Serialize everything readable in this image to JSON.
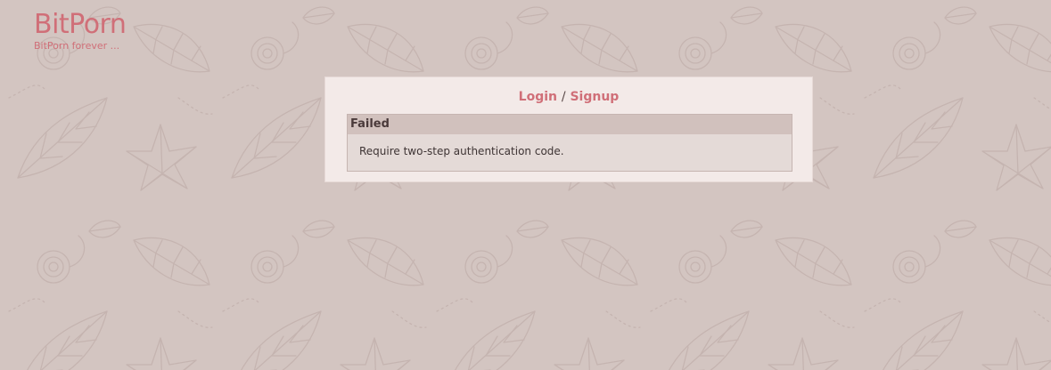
{
  "site": {
    "title": "BitPorn",
    "tagline": "BitPorn forever ..."
  },
  "auth": {
    "login_label": "Login",
    "separator": "/",
    "signup_label": "Signup"
  },
  "message": {
    "title": "Failed",
    "text": "Require two-step authentication code."
  },
  "colors": {
    "accent": "#d06f78",
    "background": "#d3c5c1",
    "panel": "#f3eae8",
    "message_header": "#d1c1bd",
    "message_body": "#e4dad7"
  }
}
